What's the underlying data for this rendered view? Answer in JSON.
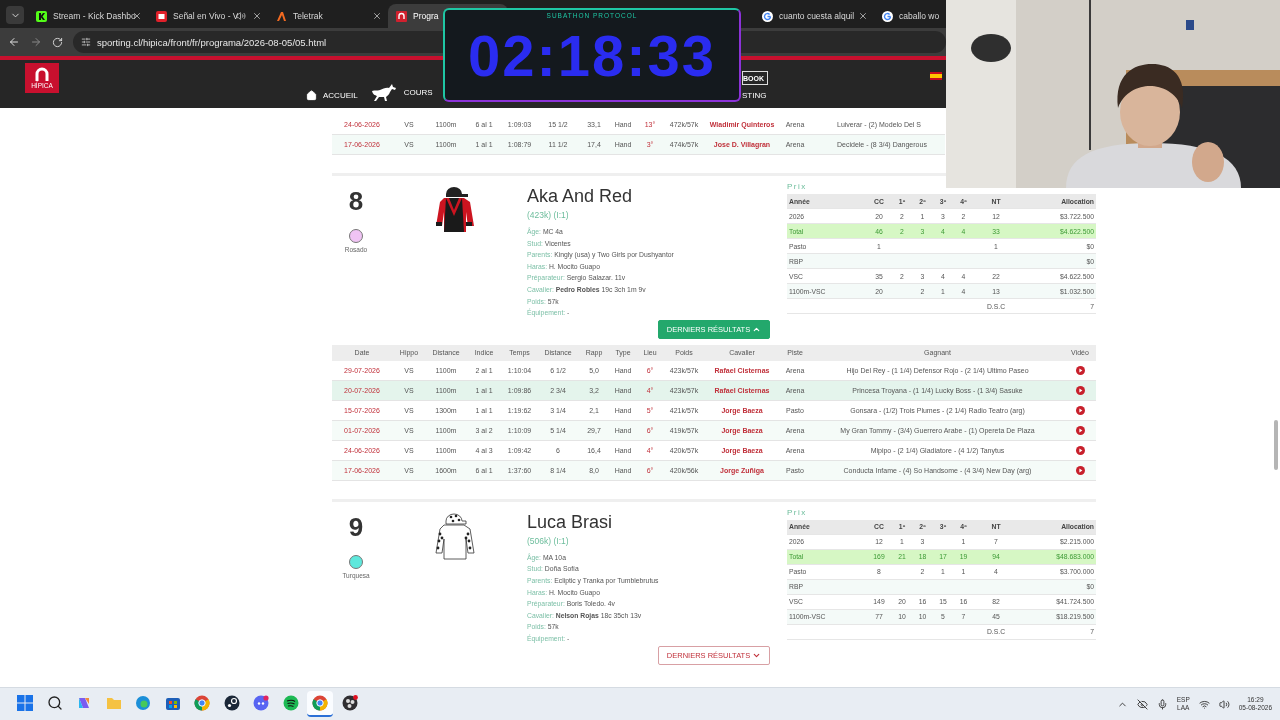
{
  "browser": {
    "tabs": [
      {
        "kind": "kick",
        "title": "Stream - Kick Dashbo",
        "selected": false,
        "playing_audio": false
      },
      {
        "kind": "video",
        "title": "Señal en Vivo - V",
        "selected": false,
        "playing_audio": true
      },
      {
        "kind": "teletrak",
        "title": "Teletrak",
        "selected": false,
        "playing_audio": false
      },
      {
        "kind": "site",
        "title": "Progra",
        "selected": true,
        "playing_audio": false
      },
      {
        "kind": "google",
        "title": "cuanto cuesta alquil",
        "selected": false,
        "playing_audio": false
      },
      {
        "kind": "google",
        "title": "caballo wo",
        "selected": false,
        "playing_audio": false
      }
    ],
    "address": "sporting.cl/hipica/front/fr/programa/2026-08-05/05.html"
  },
  "site": {
    "logo_text": "HÍPICA",
    "nav": [
      {
        "kind": "home",
        "label": "ACCUEIL"
      },
      {
        "kind": "horse",
        "label": "COURS"
      }
    ],
    "book_button": "BOOK",
    "nav_right": "STING"
  },
  "timer": {
    "title": "SUBATHON PROTOCOL",
    "time": "02:18:33"
  },
  "previous_rows": [
    [
      "24-06-2026",
      "VS",
      "1100m",
      "6 al 1",
      "1:09:03",
      "15 1/2",
      "33,1",
      "Hand",
      "13°",
      "472k/57k",
      "Wladimir Quinteros",
      "Arena",
      "Luiverar - (2) Modelo Del S"
    ],
    [
      "17-06-2026",
      "VS",
      "1100m",
      "1 al 1",
      "1:08:79",
      "11 1/2",
      "17,4",
      "Hand",
      "3°",
      "474k/57k",
      "Jose D. Villagran",
      "Arena",
      "Decidele - (8 3/4) Dangerous"
    ]
  ],
  "horses": [
    {
      "number": "8",
      "color": "#f0c4f4",
      "color_name": "Rosado",
      "silks": {
        "kind": "red_black"
      },
      "name": "Aka And Red",
      "subtitle": "(423k) (I:1)",
      "details": [
        {
          "label": "Âge:",
          "value": "MC 4a"
        },
        {
          "label": "Stud:",
          "value": "Vicentes"
        },
        {
          "label": "Parents:",
          "value": "Kingly (usa) y Two Girls por Dushyantor"
        },
        {
          "label": "Haras:",
          "value": "H. Mocito Guapo"
        },
        {
          "label": "Préparateur:",
          "value": "Sergio Salazar. 11v"
        },
        {
          "label": "Cavalier:",
          "value": "**Pedro Robles** 19c 3ch 1m 9v"
        },
        {
          "label": "Poids:",
          "value": "57k"
        },
        {
          "label": "Équipement:",
          "value": "-"
        }
      ],
      "prix": {
        "title": "Prix",
        "columns": [
          "Année",
          "CC",
          "1º",
          "2º",
          "3º",
          "4º",
          "NT",
          "Allocation"
        ],
        "rows": [
          {
            "kind": "normal",
            "cells": [
              "2026",
              "20",
              "2",
              "1",
              "3",
              "2",
              "12",
              "$3.722.500"
            ]
          },
          {
            "kind": "total",
            "cells": [
              "Total",
              "46",
              "2",
              "3",
              "4",
              "4",
              "33",
              "$4.622.500"
            ]
          },
          {
            "kind": "normal",
            "cells": [
              "Pasto",
              "1",
              null,
              null,
              null,
              null,
              "1",
              "$0"
            ]
          },
          {
            "kind": "normal",
            "cells": [
              "RBP",
              null,
              null,
              null,
              null,
              null,
              null,
              "$0"
            ]
          },
          {
            "kind": "normal",
            "cells": [
              "VSC",
              "35",
              "2",
              "3",
              "4",
              "4",
              "22",
              "$4.622.500"
            ]
          },
          {
            "kind": "normal",
            "cells": [
              "1100m-VSC",
              "20",
              null,
              "2",
              "1",
              "4",
              "13",
              "$1.032.500"
            ]
          }
        ],
        "footer": {
          "label": "D.S.C",
          "value": "7"
        }
      },
      "results_button": {
        "label": "DERNIERS RÉSULTATS",
        "expanded": true
      },
      "results": {
        "columns": [
          "Date",
          "Hippo",
          "Distance",
          "Indice",
          "Temps",
          "Distance",
          "Rapp",
          "Type",
          "Lieu",
          "Poids",
          "Cavalier",
          "Piste",
          "Gagnant",
          "Vidéo"
        ],
        "rows": [
          {
            "highlighted": false,
            "cells": [
              "29-07-2026",
              "VS",
              "1100m",
              "2 al 1",
              "1:10:04",
              "6 1/2",
              "5,0",
              "Hand",
              "6°",
              "423k/57k",
              "Rafael Cisternas",
              "Arena",
              "Hijo Del Rey - (1 1/4) Defensor Rojo - (2 1/4) Ultimo Paseo"
            ]
          },
          {
            "highlighted": true,
            "cells": [
              "20-07-2026",
              "VS",
              "1100m",
              "1 al 1",
              "1:09:86",
              "2 3/4",
              "3,2",
              "Hand",
              "4°",
              "423k/57k",
              "Rafael Cisternas",
              "Arena",
              "Princesa Troyana - (1 1/4) Lucky Boss - (1 3/4) Sasuke"
            ]
          },
          {
            "highlighted": false,
            "cells": [
              "15-07-2026",
              "VS",
              "1300m",
              "1 al 1",
              "1:19:62",
              "3 1/4",
              "2,1",
              "Hand",
              "5°",
              "421k/57k",
              "Jorge Baeza",
              "Pasto",
              "Gonsara - (1/2) Trois Plumes - (2 1/4) Radio Teatro (arg)"
            ]
          },
          {
            "highlighted": false,
            "cells": [
              "01-07-2026",
              "VS",
              "1100m",
              "3 al 2",
              "1:10:09",
              "5 1/4",
              "29,7",
              "Hand",
              "6°",
              "419k/57k",
              "Jorge Baeza",
              "Arena",
              "My Gran Tommy - (3/4) Guerrero Arabe - (1) Opereta De Plaza"
            ]
          },
          {
            "highlighted": false,
            "cells": [
              "24-06-2026",
              "VS",
              "1100m",
              "4 al 3",
              "1:09:42",
              "6",
              "16,4",
              "Hand",
              "4°",
              "420k/57k",
              "Jorge Baeza",
              "Arena",
              "Mipipo - (2 1/4) Gladiatore - (4 1/2) Tanytus"
            ]
          },
          {
            "highlighted": false,
            "cells": [
              "17-06-2026",
              "VS",
              "1600m",
              "6 al 1",
              "1:37:60",
              "8 1/4",
              "8,0",
              "Hand",
              "6°",
              "420k/56k",
              "Jorge Zuñiga",
              "Pasto",
              "Conducta Infame - (4) So Handsome - (4 3/4) New Day (arg)"
            ]
          }
        ]
      }
    },
    {
      "number": "9",
      "color": "#5ee8dc",
      "color_name": "Turquesa",
      "silks": {
        "kind": "white_dots"
      },
      "name": "Luca Brasi",
      "subtitle": "(506k) (I:1)",
      "details": [
        {
          "label": "Âge:",
          "value": "MA 10a"
        },
        {
          "label": "Stud:",
          "value": "Doña Sofía"
        },
        {
          "label": "Parents:",
          "value": "Ecliptic y Tranka por Tumblebrutus"
        },
        {
          "label": "Haras:",
          "value": "H. Mocito Guapo"
        },
        {
          "label": "Préparateur:",
          "value": "Boris Toledo. 4v"
        },
        {
          "label": "Cavalier:",
          "value": "**Nelson Rojas** 18c 35ch 13v"
        },
        {
          "label": "Poids:",
          "value": "57k"
        },
        {
          "label": "Équipement:",
          "value": "-"
        }
      ],
      "prix": {
        "title": "Prix",
        "columns": [
          "Année",
          "CC",
          "1º",
          "2º",
          "3º",
          "4º",
          "NT",
          "Allocation"
        ],
        "rows": [
          {
            "kind": "normal",
            "cells": [
              "2026",
              "12",
              "1",
              "3",
              null,
              "1",
              "7",
              "$2.215.000"
            ]
          },
          {
            "kind": "total",
            "cells": [
              "Total",
              "169",
              "21",
              "18",
              "17",
              "19",
              "94",
              "$48.683.000"
            ]
          },
          {
            "kind": "normal",
            "cells": [
              "Pasto",
              "8",
              null,
              "2",
              "1",
              "1",
              "4",
              "$3.700.000"
            ]
          },
          {
            "kind": "normal",
            "cells": [
              "RBP",
              null,
              null,
              null,
              null,
              null,
              null,
              "$0"
            ]
          },
          {
            "kind": "normal",
            "cells": [
              "VSC",
              "149",
              "20",
              "16",
              "15",
              "16",
              "82",
              "$41.724.500"
            ]
          },
          {
            "kind": "normal",
            "cells": [
              "1100m-VSC",
              "77",
              "10",
              "10",
              "5",
              "7",
              "45",
              "$18.219.500"
            ]
          }
        ],
        "footer": {
          "label": "D.S.C",
          "value": "7"
        }
      },
      "results_button": {
        "label": "DERNIERS RÉSULTATS",
        "expanded": false
      }
    }
  ],
  "taskbar": {
    "apps": [
      {
        "kind": "start",
        "active": false
      },
      {
        "kind": "search",
        "active": false
      },
      {
        "kind": "copilot",
        "active": false
      },
      {
        "kind": "files",
        "active": false
      },
      {
        "kind": "edge",
        "active": false
      },
      {
        "kind": "store",
        "active": false
      },
      {
        "kind": "chrome",
        "active": false
      },
      {
        "kind": "steam",
        "active": false
      },
      {
        "kind": "discord",
        "active": false
      },
      {
        "kind": "spotify",
        "active": false
      },
      {
        "kind": "chrome",
        "active": true
      },
      {
        "kind": "obs",
        "active": false
      }
    ],
    "language": "ESP",
    "layout": "LAA",
    "time": "16:29",
    "date": "05-08-2026"
  }
}
